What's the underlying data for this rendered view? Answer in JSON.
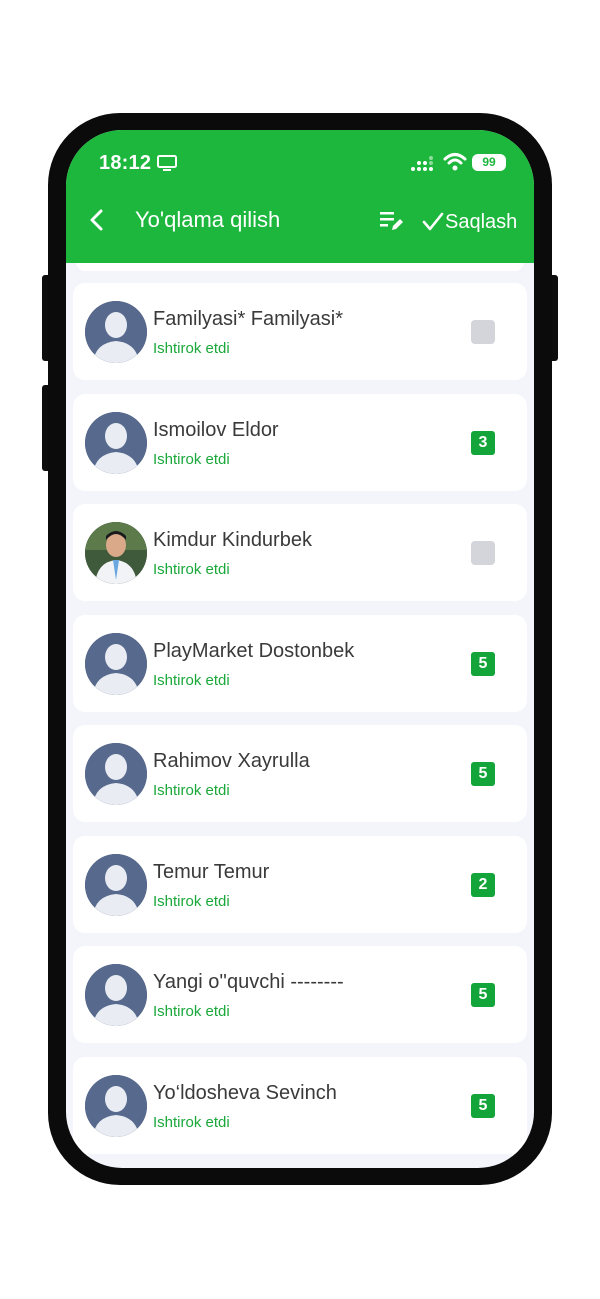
{
  "status_bar": {
    "time": "18:12",
    "battery": "99"
  },
  "header": {
    "title": "Yo'qlama qilish",
    "save_label": "Saqlash"
  },
  "students": [
    {
      "name": "Familyasi* Familyasi*",
      "status": "Ishtirok etdi",
      "grade": "",
      "avatar": "default"
    },
    {
      "name": "Ismoilov Eldor",
      "status": "Ishtirok etdi",
      "grade": "3",
      "avatar": "default"
    },
    {
      "name": "Kimdur Kindurbek",
      "status": "Ishtirok etdi",
      "grade": "",
      "avatar": "photo"
    },
    {
      "name": "PlayMarket Dostonbek",
      "status": "Ishtirok etdi",
      "grade": "5",
      "avatar": "default"
    },
    {
      "name": "Rahimov Xayrulla",
      "status": "Ishtirok etdi",
      "grade": "5",
      "avatar": "default"
    },
    {
      "name": "Temur Temur",
      "status": "Ishtirok etdi",
      "grade": "2",
      "avatar": "default"
    },
    {
      "name": "Yangi o''quvchi --------",
      "status": "Ishtirok etdi",
      "grade": "5",
      "avatar": "default"
    },
    {
      "name": "Yo‘ldosheva Sevinch",
      "status": "Ishtirok etdi",
      "grade": "5",
      "avatar": "default"
    }
  ],
  "colors": {
    "accent": "#1db73d",
    "status_text": "#1aa83a",
    "grade_badge": "#13a43a",
    "avatar_bg": "#57698c"
  }
}
